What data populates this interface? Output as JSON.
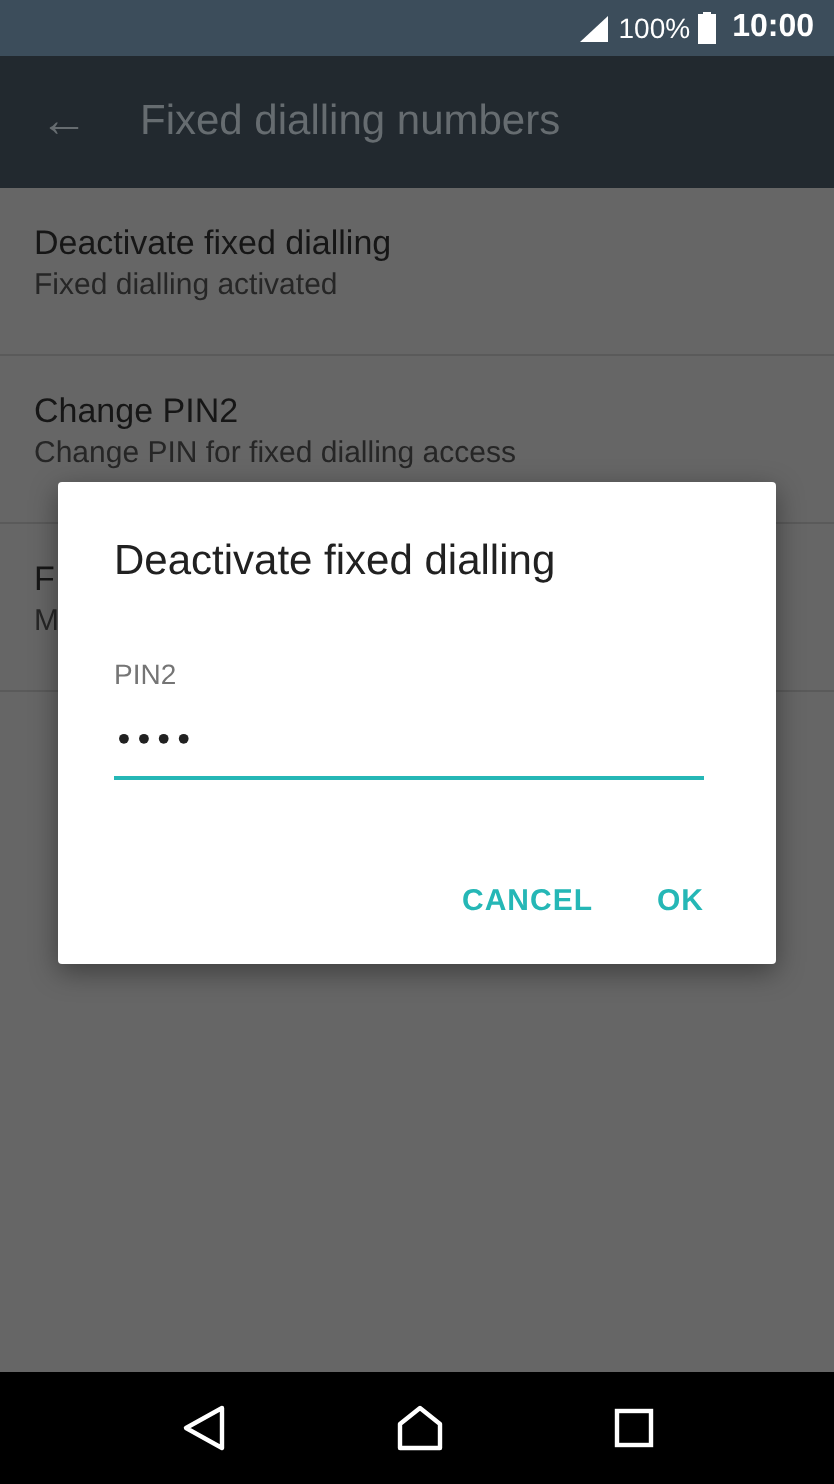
{
  "status_bar": {
    "battery": "100%",
    "time": "10:00"
  },
  "app_bar": {
    "back": "←",
    "title": "Fixed dialling numbers"
  },
  "settings": [
    {
      "title": "Deactivate fixed dialling",
      "subtitle": "Fixed dialling activated"
    },
    {
      "title": "Change PIN2",
      "subtitle": "Change PIN for fixed dialling access"
    },
    {
      "title": "F",
      "subtitle": "M"
    }
  ],
  "dialog": {
    "title": "Deactivate fixed dialling",
    "field_label": "PIN2",
    "value": "••••",
    "buttons": [
      "CANCEL",
      "OK"
    ]
  }
}
